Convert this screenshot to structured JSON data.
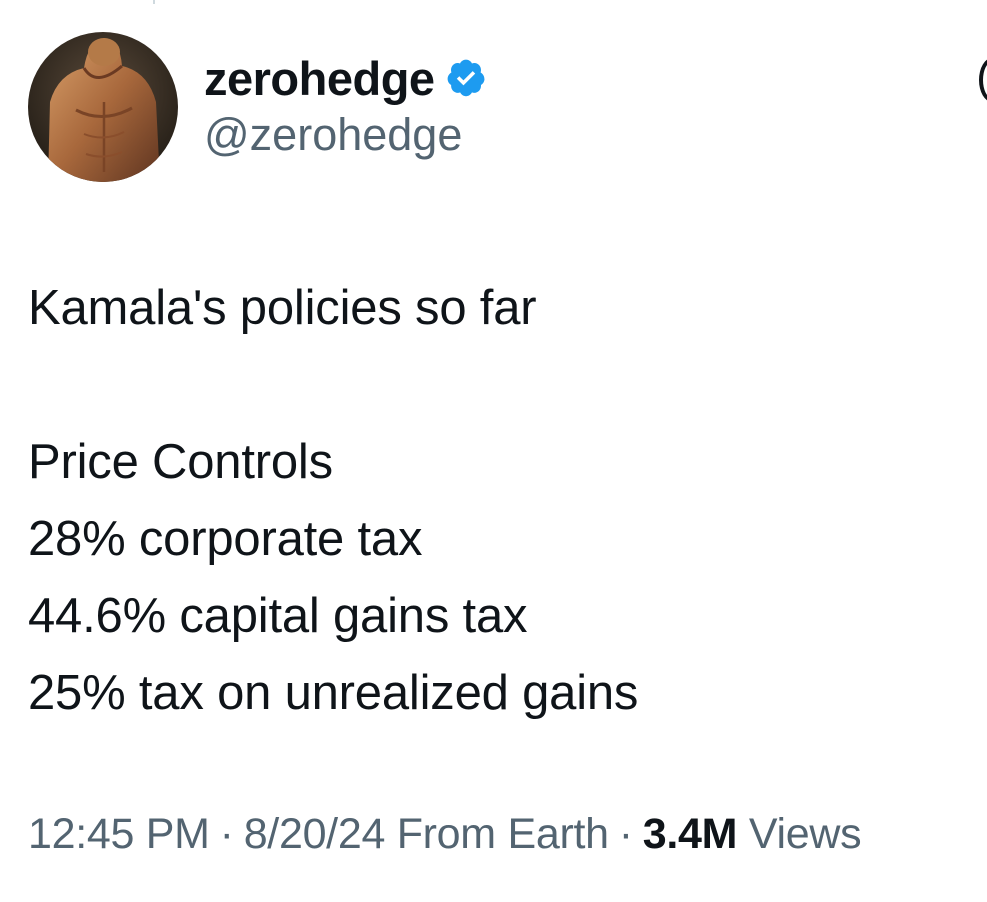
{
  "author": {
    "display_name": "zerohedge",
    "handle": "@zerohedge",
    "verified_icon": "verified-badge-icon",
    "verified_color": "#1d9bf0",
    "avatar": "profile-photo"
  },
  "tweet": {
    "intro": "Kamala's policies so far",
    "items": [
      "Price Controls",
      "28% corporate tax",
      "44.6% capital gains tax",
      "25% tax on unrealized gains"
    ]
  },
  "meta": {
    "time": "12:45 PM",
    "separator": "·",
    "date_location": "8/20/24 From Earth",
    "views_count": "3.4M",
    "views_label": "Views"
  },
  "colors": {
    "text_primary": "#0f1419",
    "text_secondary": "#536471"
  }
}
